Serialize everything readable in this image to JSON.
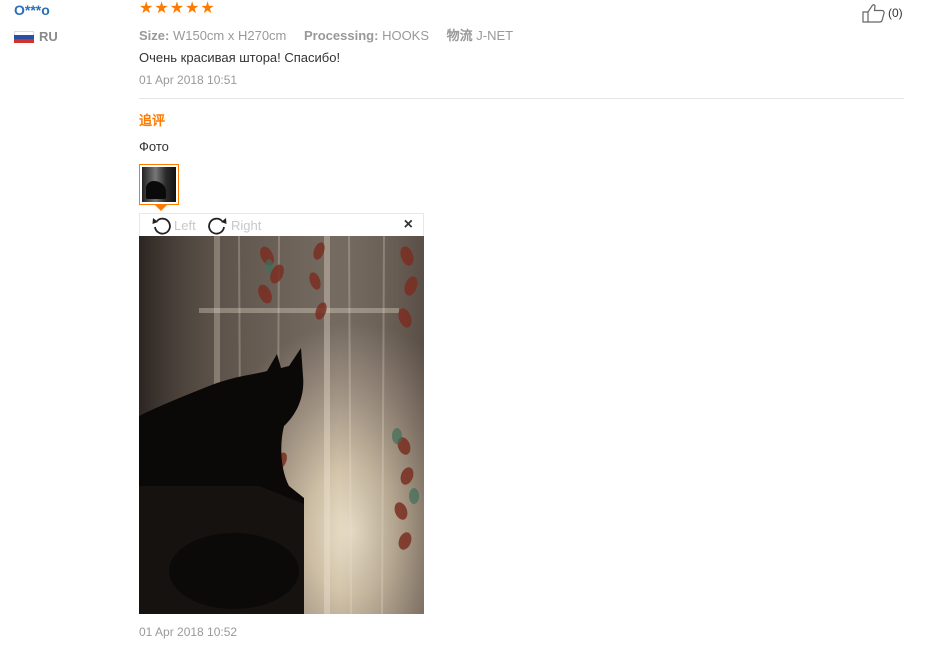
{
  "user": {
    "name": "O***o",
    "country": "RU"
  },
  "review": {
    "stars": 5,
    "helpful_count": "(0)",
    "attributes": [
      {
        "key": "Size:",
        "value": "W150cm x H270cm"
      },
      {
        "key": "Processing:",
        "value": "HOOKS"
      },
      {
        "key": "物流",
        "value": "J-NET"
      }
    ],
    "text": "Очень красивая штора! Спасибо!",
    "date": "01 Apr 2018 10:51"
  },
  "followup": {
    "label": "追评",
    "text": "Фото",
    "date": "01 Apr 2018 10:52"
  },
  "viewer": {
    "rotate_left_label": "Left",
    "rotate_right_label": "Right",
    "close_glyph": "×"
  },
  "colors": {
    "accent": "#ff7a00",
    "username": "#2a6ebb",
    "muted": "#999999"
  }
}
